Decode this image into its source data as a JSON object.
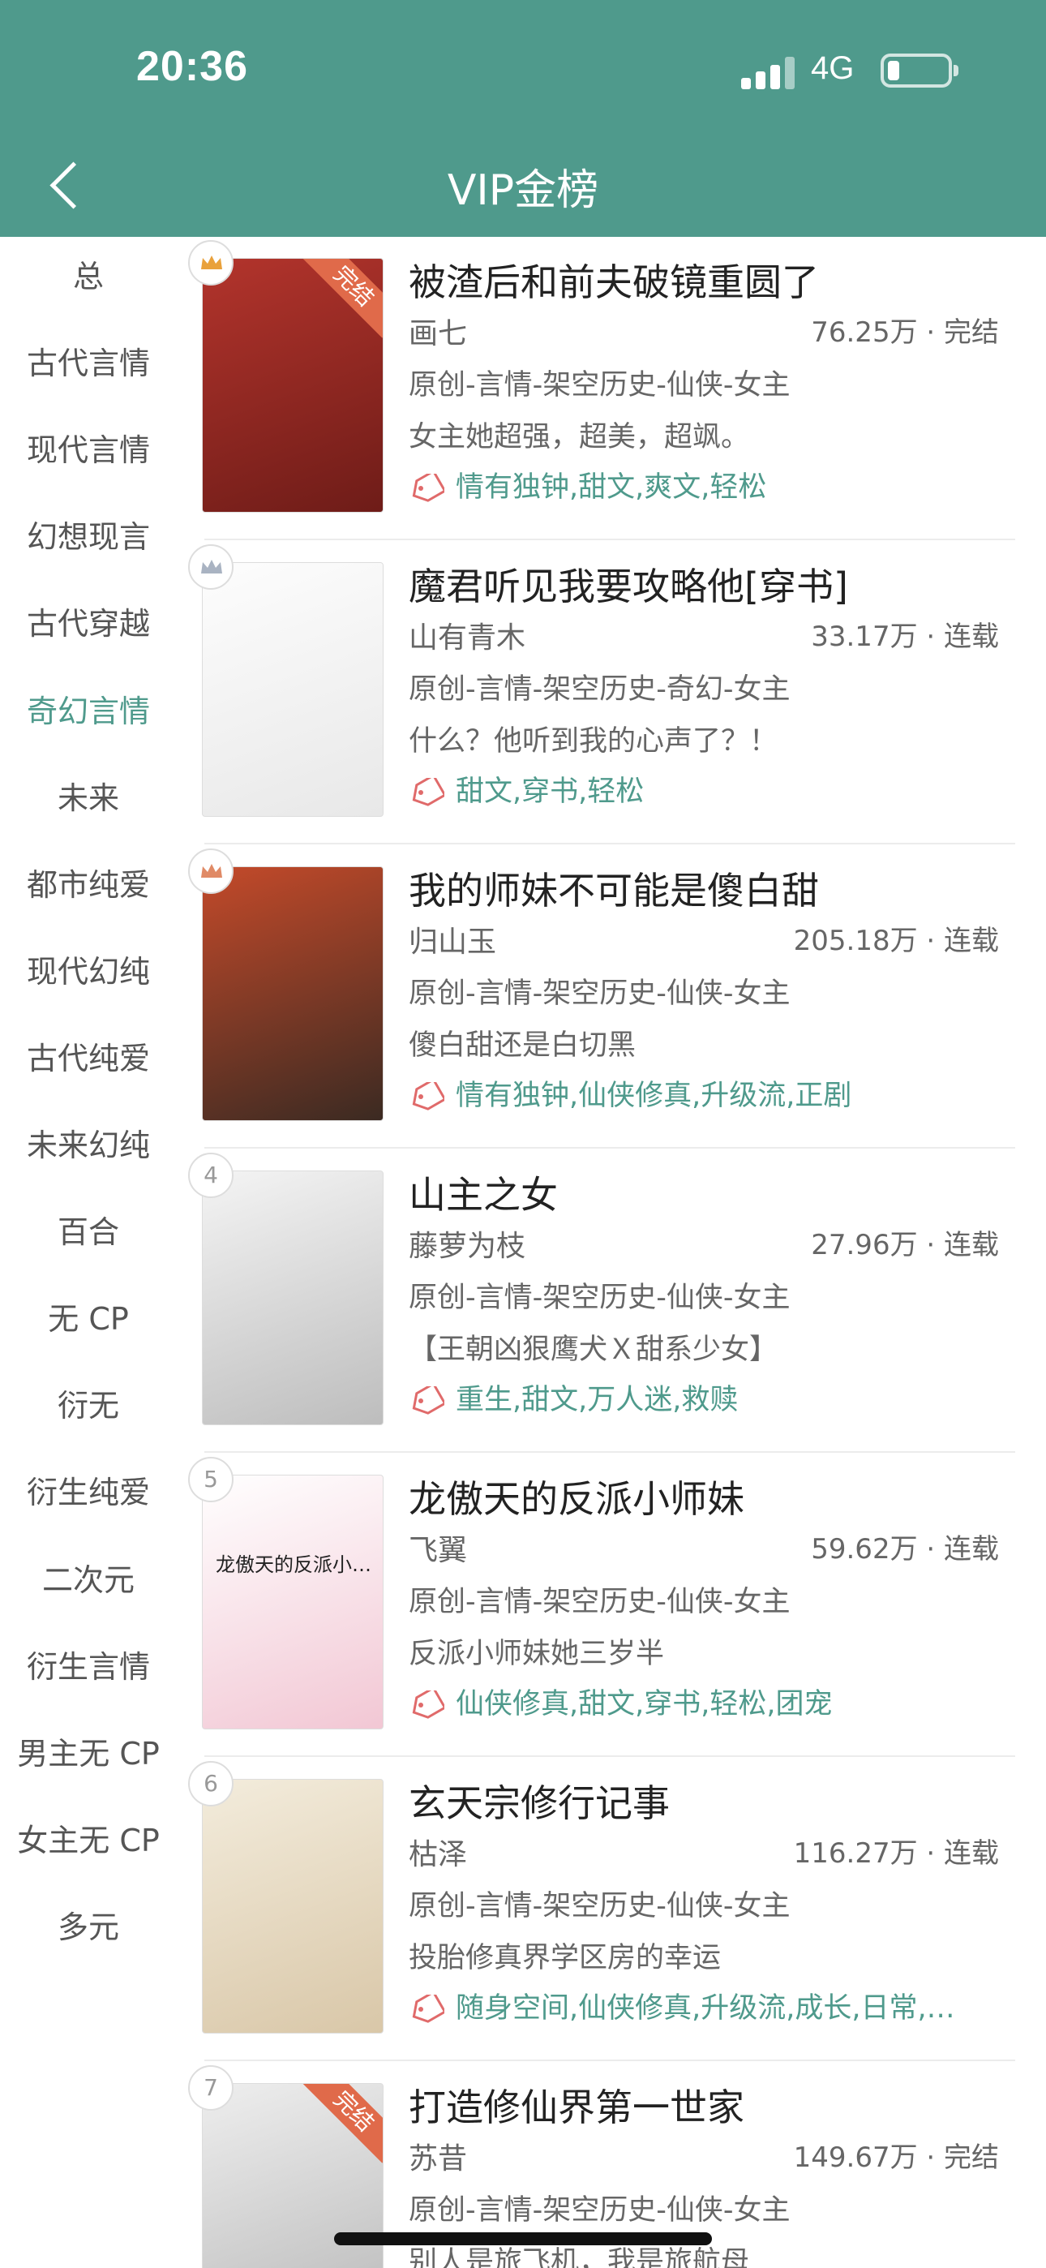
{
  "status": {
    "time": "20:36",
    "network": "4G"
  },
  "nav": {
    "title": "VIP金榜"
  },
  "sidebar": {
    "items": [
      {
        "label": "总"
      },
      {
        "label": "古代言情"
      },
      {
        "label": "现代言情"
      },
      {
        "label": "幻想现言"
      },
      {
        "label": "古代穿越"
      },
      {
        "label": "奇幻言情"
      },
      {
        "label": "未来"
      },
      {
        "label": "都市纯爱"
      },
      {
        "label": "现代幻纯"
      },
      {
        "label": "古代纯爱"
      },
      {
        "label": "未来幻纯"
      },
      {
        "label": "百合"
      },
      {
        "label": "无 CP"
      },
      {
        "label": "衍无"
      },
      {
        "label": "衍生纯爱"
      },
      {
        "label": "二次元"
      },
      {
        "label": "衍生言情"
      },
      {
        "label": "男主无 CP"
      },
      {
        "label": "女主无 CP"
      },
      {
        "label": "多元"
      }
    ],
    "active_index": 5
  },
  "books": [
    {
      "rank": "",
      "crown": "gold",
      "status_ribbon": "完结",
      "cover_colors": [
        "#b3342c",
        "#6e1c18"
      ],
      "title": "被渣后和前夫破镜重圆了",
      "author": "画七",
      "meta": "76.25万 · 完结",
      "genre": "原创-言情-架空历史-仙侠-女主",
      "desc": "女主她超强，超美，超飒。",
      "tags": "情有独钟,甜文,爽文,轻松"
    },
    {
      "rank": "",
      "crown": "silver",
      "status_ribbon": "",
      "cover_colors": [
        "#fdfdfd",
        "#e8e8e8"
      ],
      "title": "魔君听见我要攻略他[穿书]",
      "author": "山有青木",
      "meta": "33.17万 · 连载",
      "genre": "原创-言情-架空历史-奇幻-女主",
      "desc": "什么？他听到我的心声了？！",
      "tags": "甜文,穿书,轻松"
    },
    {
      "rank": "",
      "crown": "bronze",
      "status_ribbon": "",
      "cover_colors": [
        "#c44a2a",
        "#3b2a22"
      ],
      "title": "我的师妹不可能是傻白甜",
      "author": "归山玉",
      "meta": "205.18万 · 连载",
      "genre": "原创-言情-架空历史-仙侠-女主",
      "desc": "傻白甜还是白切黑",
      "tags": "情有独钟,仙侠修真,升级流,正剧"
    },
    {
      "rank": "4",
      "crown": "",
      "status_ribbon": "",
      "cover_colors": [
        "#f4f4f4",
        "#bdbdbd"
      ],
      "title": "山主之女",
      "author": "藤萝为枝",
      "meta": "27.96万 · 连载",
      "genre": "原创-言情-架空历史-仙侠-女主",
      "desc": "【王朝凶狠鹰犬Ｘ甜系少女】",
      "tags": "重生,甜文,万人迷,救赎"
    },
    {
      "rank": "5",
      "crown": "",
      "status_ribbon": "",
      "cover_colors": [
        "#ffffff",
        "#f2c7d4"
      ],
      "cover_text": "龙傲天的反派小…",
      "title": "龙傲天的反派小师妹",
      "author": "飞翼",
      "meta": "59.62万 · 连载",
      "genre": "原创-言情-架空历史-仙侠-女主",
      "desc": "反派小师妹她三岁半",
      "tags": "仙侠修真,甜文,穿书,轻松,团宠"
    },
    {
      "rank": "6",
      "crown": "",
      "status_ribbon": "",
      "cover_colors": [
        "#f3ecdc",
        "#d9c7a8"
      ],
      "title": "玄天宗修行记事",
      "author": "枯泽",
      "meta": "116.27万 · 连载",
      "genre": "原创-言情-架空历史-仙侠-女主",
      "desc": "投胎修真界学区房的幸运",
      "tags": "随身空间,仙侠修真,升级流,成长,日常,…"
    },
    {
      "rank": "7",
      "crown": "",
      "status_ribbon": "完结",
      "cover_colors": [
        "#eeeeee",
        "#b8b8b8"
      ],
      "title": "打造修仙界第一世家",
      "author": "苏昔",
      "meta": "149.67万 · 完结",
      "genre": "原创-言情-架空历史-仙侠-女主",
      "desc": "别人是旅飞机，我是旅航母",
      "tags": ""
    }
  ],
  "colors": {
    "accent": "#4f9a8c",
    "header": "#4f9a8c",
    "ribbon": "#e06a4a"
  },
  "icons": {
    "back": "chevron-left-icon",
    "tag": "tag-icon",
    "crown": "crown-icon"
  }
}
